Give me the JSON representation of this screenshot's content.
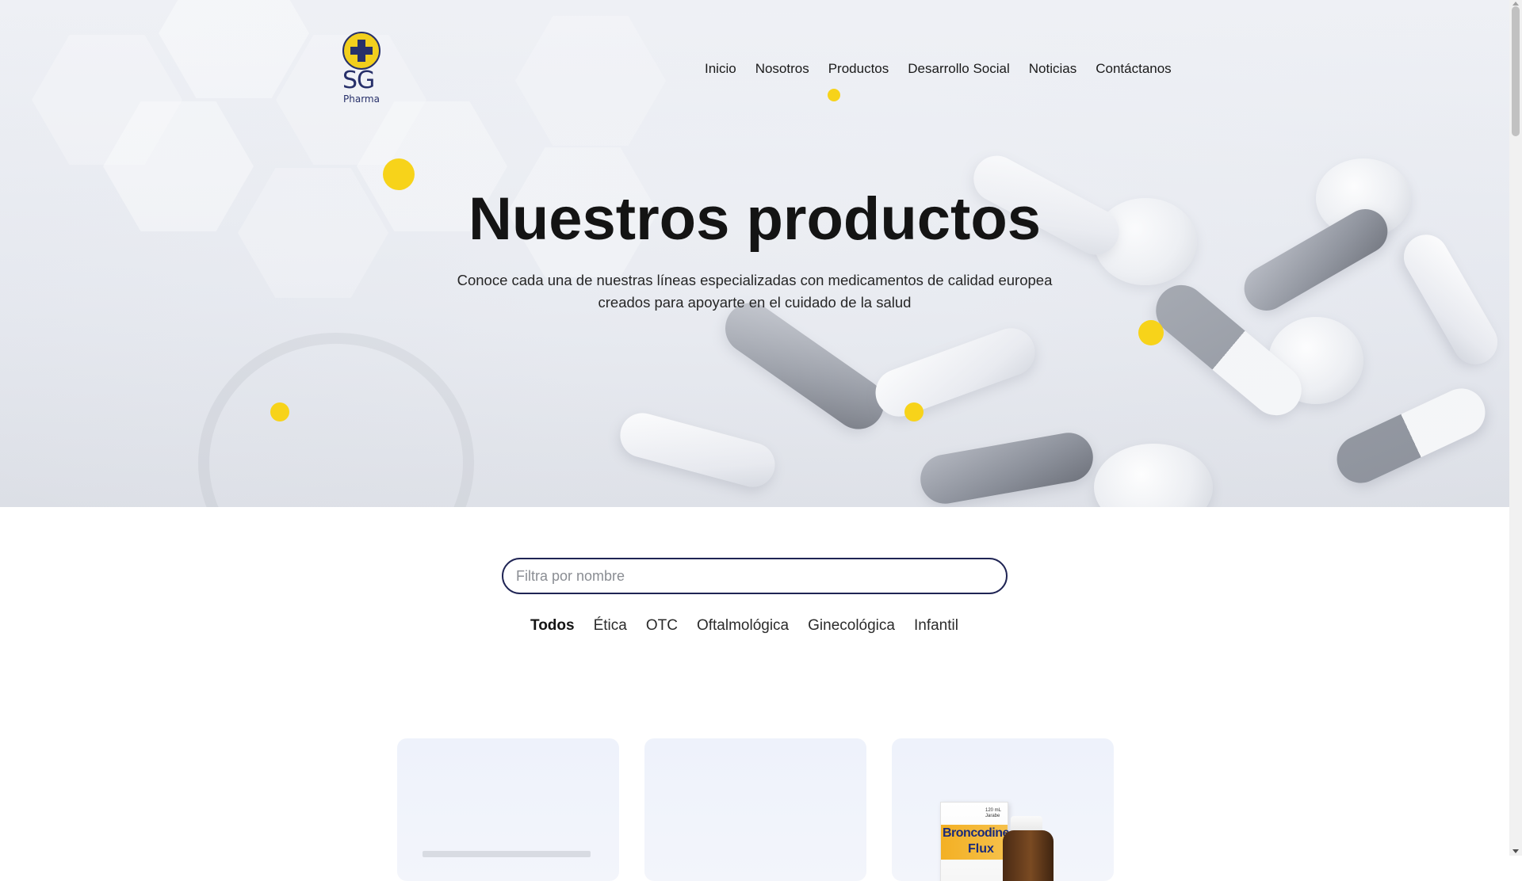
{
  "brand": {
    "logo_text": "SG",
    "logo_subtext": "Pharma",
    "accent_color": "#f7d31a",
    "navy_color": "#27306a"
  },
  "nav": {
    "items": [
      {
        "label": "Inicio"
      },
      {
        "label": "Nosotros"
      },
      {
        "label": "Productos"
      },
      {
        "label": "Desarrollo Social"
      },
      {
        "label": "Noticias"
      },
      {
        "label": "Contáctanos"
      }
    ]
  },
  "hero": {
    "title": "Nuestros productos",
    "subtitle_line1": "Conoce cada una de nuestras líneas especializadas con medicamentos de calidad europea",
    "subtitle_line2": "creados para apoyarte en el cuidado de la salud"
  },
  "filter": {
    "search_placeholder": "Filtra por nombre",
    "search_value": "",
    "active_tab": "Todos",
    "tabs": [
      {
        "label": "Todos"
      },
      {
        "label": "Ética"
      },
      {
        "label": "OTC"
      },
      {
        "label": "Oftalmológica"
      },
      {
        "label": "Ginecológica"
      },
      {
        "label": "Infantil"
      }
    ]
  },
  "products": [
    {
      "name": ""
    },
    {
      "name": ""
    },
    {
      "name": "Broncodine Flux",
      "package_text_line1": "Broncodine",
      "package_text_line2": "Flux",
      "volume": "120 mL Jarabe"
    }
  ]
}
